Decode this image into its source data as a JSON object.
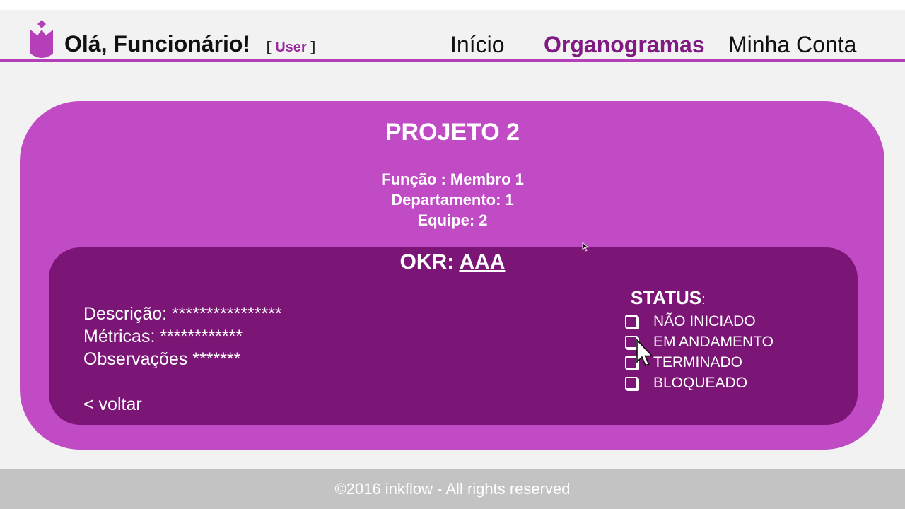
{
  "header": {
    "greeting": "Olá, Funcionário!",
    "role_open": "[",
    "role_name": "User",
    "role_close": "]",
    "nav": [
      {
        "label": "Início",
        "active": false
      },
      {
        "label": "Organogramas",
        "active": true
      },
      {
        "label": "Minha Conta",
        "active": false
      }
    ]
  },
  "project": {
    "title": "PROJETO 2",
    "funcao": "Função : Membro 1",
    "departamento": "Departamento: 1",
    "equipe": "Equipe: 2"
  },
  "okr": {
    "label": "OKR: ",
    "name": "AAA",
    "descricao": "Descrição: ****************",
    "metricas": "Métricas: ************",
    "observacoes": "Observações *******",
    "back": "< voltar"
  },
  "status": {
    "title": "STATUS",
    "colon": ":",
    "options": [
      "NÃO INICIADO",
      "EM ANDAMENTO",
      "TERMINADO",
      "BLOQUEADO"
    ]
  },
  "footer": {
    "text": "©2016  inkflow - All rights reserved"
  },
  "colors": {
    "accent": "#b53fb9",
    "card": "#c04bc5",
    "inner": "#7b1677",
    "active_nav": "#7e1a82"
  },
  "icons": [
    "tulip-logo-icon",
    "checkbox-icon",
    "mouse-cursor-icon"
  ]
}
